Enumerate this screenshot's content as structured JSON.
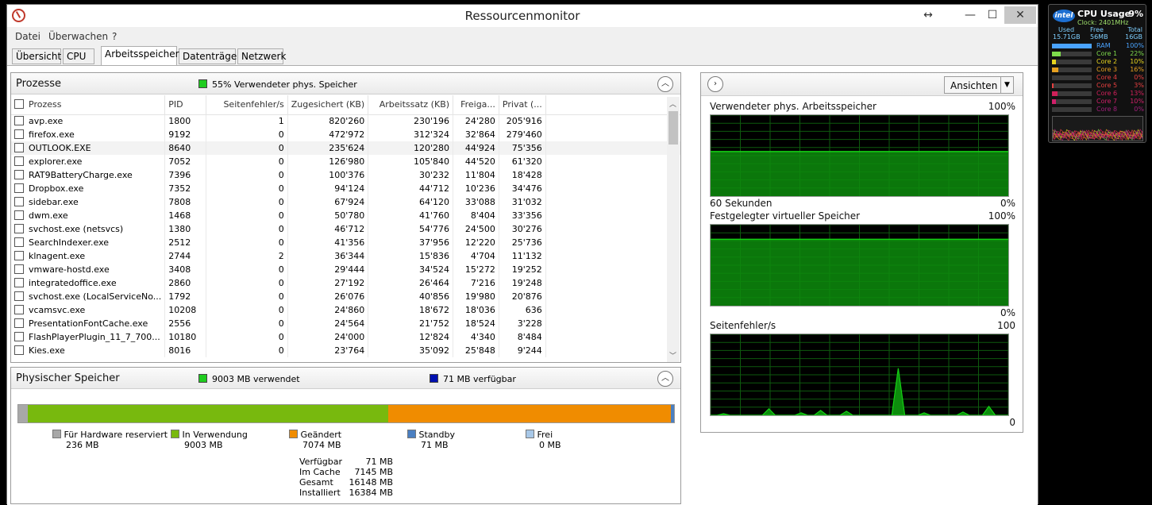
{
  "window": {
    "title": "Ressourcenmonitor"
  },
  "titlebar": {
    "resize_glyph": "↔",
    "minimize_glyph": "—",
    "maximize_glyph": "☐",
    "close_glyph": "✕"
  },
  "menu": [
    "Datei",
    "Überwachen",
    "?"
  ],
  "tabs": [
    "Übersicht",
    "CPU",
    "Arbeitsspeicher",
    "Datenträger",
    "Netzwerk"
  ],
  "active_tab": "Arbeitsspeicher",
  "colors": {
    "green": "#78b90e",
    "orange": "#f08c00",
    "gray": "#a8a8a8",
    "blue": "#4a7fc1",
    "lightblue": "#a8c8e8",
    "graph_fill": "#0d8c0d",
    "graph_line": "#14d214",
    "graph_grid": "#0e5a0e"
  },
  "processes": {
    "title": "Prozesse",
    "legend": "55% Verwendeter phys. Speicher",
    "columns": [
      "Prozess",
      "PID",
      "Seitenfehler/s",
      "Zugesichert (KB)",
      "Arbeitssatz (KB)",
      "Freiga...",
      "Privat (..."
    ],
    "rows": [
      [
        "avp.exe",
        "1800",
        "1",
        "820'260",
        "230'196",
        "24'280",
        "205'916"
      ],
      [
        "firefox.exe",
        "9192",
        "0",
        "472'972",
        "312'324",
        "32'864",
        "279'460"
      ],
      [
        "OUTLOOK.EXE",
        "8640",
        "0",
        "235'624",
        "120'280",
        "44'924",
        "75'356"
      ],
      [
        "explorer.exe",
        "7052",
        "0",
        "126'980",
        "105'840",
        "44'520",
        "61'320"
      ],
      [
        "RAT9BatteryCharge.exe",
        "7396",
        "0",
        "100'376",
        "30'232",
        "11'804",
        "18'428"
      ],
      [
        "Dropbox.exe",
        "7352",
        "0",
        "94'124",
        "44'712",
        "10'236",
        "34'476"
      ],
      [
        "sidebar.exe",
        "7808",
        "0",
        "67'924",
        "64'120",
        "33'088",
        "31'032"
      ],
      [
        "dwm.exe",
        "1468",
        "0",
        "50'780",
        "41'760",
        "8'404",
        "33'356"
      ],
      [
        "svchost.exe (netsvcs)",
        "1380",
        "0",
        "46'712",
        "54'776",
        "24'500",
        "30'276"
      ],
      [
        "SearchIndexer.exe",
        "2512",
        "0",
        "41'356",
        "37'956",
        "12'220",
        "25'736"
      ],
      [
        "klnagent.exe",
        "2744",
        "2",
        "36'344",
        "15'836",
        "4'704",
        "11'132"
      ],
      [
        "vmware-hostd.exe",
        "3408",
        "0",
        "29'444",
        "34'524",
        "15'272",
        "19'252"
      ],
      [
        "integratedoffice.exe",
        "2860",
        "0",
        "27'192",
        "26'464",
        "7'216",
        "19'248"
      ],
      [
        "svchost.exe (LocalServiceNo...",
        "1792",
        "0",
        "26'076",
        "40'856",
        "19'980",
        "20'876"
      ],
      [
        "vcamsvc.exe",
        "10208",
        "0",
        "24'860",
        "18'672",
        "18'036",
        "636"
      ],
      [
        "PresentationFontCache.exe",
        "2556",
        "0",
        "24'564",
        "21'752",
        "18'524",
        "3'228"
      ],
      [
        "FlashPlayerPlugin_11_7_700...",
        "10180",
        "0",
        "24'000",
        "12'824",
        "4'340",
        "8'484"
      ],
      [
        "Kies.exe",
        "8016",
        "0",
        "23'764",
        "35'092",
        "25'848",
        "9'244"
      ]
    ]
  },
  "physical": {
    "title": "Physischer Speicher",
    "legend_used": "9003 MB verwendet",
    "legend_free": "71 MB verfügbar",
    "bar_mb": {
      "reserved": 236,
      "in_use": 9003,
      "modified": 7074,
      "standby": 71,
      "free": 0
    },
    "categories": [
      {
        "label": "Für Hardware reserviert",
        "value": "236 MB"
      },
      {
        "label": "In Verwendung",
        "value": "9003 MB"
      },
      {
        "label": "Geändert",
        "value": "7074 MB"
      },
      {
        "label": "Standby",
        "value": "71 MB"
      },
      {
        "label": "Frei",
        "value": "0 MB"
      }
    ],
    "summary": [
      {
        "label": "Verfügbar",
        "value": "71 MB"
      },
      {
        "label": "Im Cache",
        "value": "7145 MB"
      },
      {
        "label": "Gesamt",
        "value": "16148 MB"
      },
      {
        "label": "Installiert",
        "value": "16384 MB"
      }
    ]
  },
  "graphs_panel": {
    "view_button": "Ansichten",
    "graphs": [
      {
        "title": "Verwendeter phys. Arbeitsspeicher",
        "max_label": "100%",
        "min_label": "0%",
        "time_label": "60 Sekunden",
        "level": 0.55
      },
      {
        "title": "Festgelegter virtueller Speicher",
        "max_label": "100%",
        "min_label": "0%",
        "level": 0.82
      },
      {
        "title": "Seitenfehler/s",
        "max_label": "100",
        "min_label": "0"
      }
    ]
  },
  "gadget": {
    "brand": "intel",
    "title": "CPU Usage",
    "cpu": "9%",
    "clock": "Clock: 2401MHz",
    "headers": [
      "Used",
      "Free",
      "Total"
    ],
    "values": [
      "15.71GB",
      "56MB",
      "16GB"
    ],
    "rows": [
      {
        "label": "RAM",
        "value": "100%",
        "level": 1.0,
        "color": "#4aa3ff"
      },
      {
        "label": "Core 1",
        "value": "22%",
        "level": 0.22,
        "color": "#7fdc4c"
      },
      {
        "label": "Core 2",
        "value": "10%",
        "level": 0.1,
        "color": "#e6d420"
      },
      {
        "label": "Core 3",
        "value": "16%",
        "level": 0.16,
        "color": "#e6a020"
      },
      {
        "label": "Core 4",
        "value": "0%",
        "level": 0.0,
        "color": "#e64040"
      },
      {
        "label": "Core 5",
        "value": "3%",
        "level": 0.03,
        "color": "#e64040"
      },
      {
        "label": "Core 6",
        "value": "13%",
        "level": 0.13,
        "color": "#d0205a"
      },
      {
        "label": "Core 7",
        "value": "10%",
        "level": 0.1,
        "color": "#d0206a"
      },
      {
        "label": "Core 8",
        "value": "0%",
        "level": 0.0,
        "color": "#a0207a"
      }
    ]
  }
}
